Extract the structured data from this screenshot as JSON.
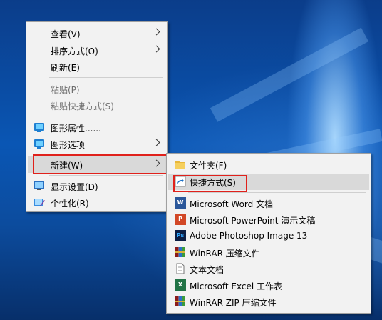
{
  "context_menu": {
    "items": [
      {
        "label": "查看(V)"
      },
      {
        "label": "排序方式(O)"
      },
      {
        "label": "刷新(E)"
      },
      {
        "label": "粘贴(P)"
      },
      {
        "label": "粘贴快捷方式(S)"
      },
      {
        "label": "图形属性......"
      },
      {
        "label": "图形选项"
      },
      {
        "label": "新建(W)"
      },
      {
        "label": "显示设置(D)"
      },
      {
        "label": "个性化(R)"
      }
    ]
  },
  "new_submenu": {
    "items": [
      {
        "label": "文件夹(F)",
        "icon": "folder-icon"
      },
      {
        "label": "快捷方式(S)",
        "icon": "shortcut-icon"
      },
      {
        "label": "Microsoft Word 文档",
        "icon": "word-icon"
      },
      {
        "label": "Microsoft PowerPoint 演示文稿",
        "icon": "powerpoint-icon"
      },
      {
        "label": "Adobe Photoshop Image 13",
        "icon": "photoshop-icon"
      },
      {
        "label": "WinRAR 压缩文件",
        "icon": "winrar-icon"
      },
      {
        "label": "文本文档",
        "icon": "text-document-icon"
      },
      {
        "label": "Microsoft Excel 工作表",
        "icon": "excel-icon"
      },
      {
        "label": "WinRAR ZIP 压缩文件",
        "icon": "winrar-zip-icon"
      }
    ]
  },
  "colors": {
    "highlight": "#d9d9d9",
    "annotation_red": "#e0211b",
    "desktop_blue": "#0a56b4"
  }
}
